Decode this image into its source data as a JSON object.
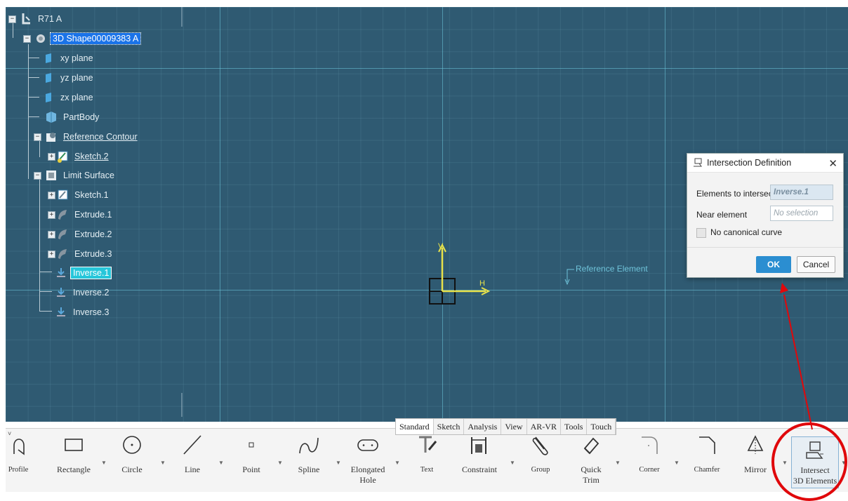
{
  "tree": {
    "root": "R71 A",
    "shape": "3D Shape00009383 A",
    "items": [
      {
        "label": "xy plane"
      },
      {
        "label": "yz plane"
      },
      {
        "label": "zx plane"
      },
      {
        "label": "PartBody"
      },
      {
        "label": "Reference Contour"
      },
      {
        "label": "Sketch.2"
      },
      {
        "label": "Limit Surface"
      },
      {
        "label": "Sketch.1"
      },
      {
        "label": "Extrude.1"
      },
      {
        "label": "Extrude.2"
      },
      {
        "label": "Extrude.3"
      },
      {
        "label": "Inverse.1"
      },
      {
        "label": "Inverse.2"
      },
      {
        "label": "Inverse.3"
      }
    ]
  },
  "viewport": {
    "axis_v_label": "V",
    "axis_h_label": "H",
    "reference_element": "Reference Element"
  },
  "dialog": {
    "title": "Intersection Definition",
    "elements_label": "Elements to intersect",
    "elements_value": "Inverse.1",
    "near_label": "Near element",
    "near_value": "No selection",
    "canonical_label": "No canonical curve",
    "ok": "OK",
    "cancel": "Cancel"
  },
  "tabs": [
    "Standard",
    "Sketch",
    "Analysis",
    "View",
    "AR-VR",
    "Tools",
    "Touch"
  ],
  "toolbar": {
    "profile": "Profile",
    "rectangle": "Rectangle",
    "circle": "Circle",
    "line": "Line",
    "point": "Point",
    "spline": "Spline",
    "elongated_1": "Elongated",
    "elongated_2": "Hole",
    "text": "Text",
    "constraint": "Constraint",
    "group": "Group",
    "quick_1": "Quick",
    "quick_2": "Trim",
    "corner": "Corner",
    "chamfer": "Chamfer",
    "mirror": "Mirror",
    "intersect_1": "Intersect",
    "intersect_2": "3D Elements"
  },
  "colors": {
    "viewport_bg": "#2f5a72",
    "axis": "#e8e24a",
    "highlight": "#e0080b",
    "ok_button": "#2b8ed1"
  }
}
